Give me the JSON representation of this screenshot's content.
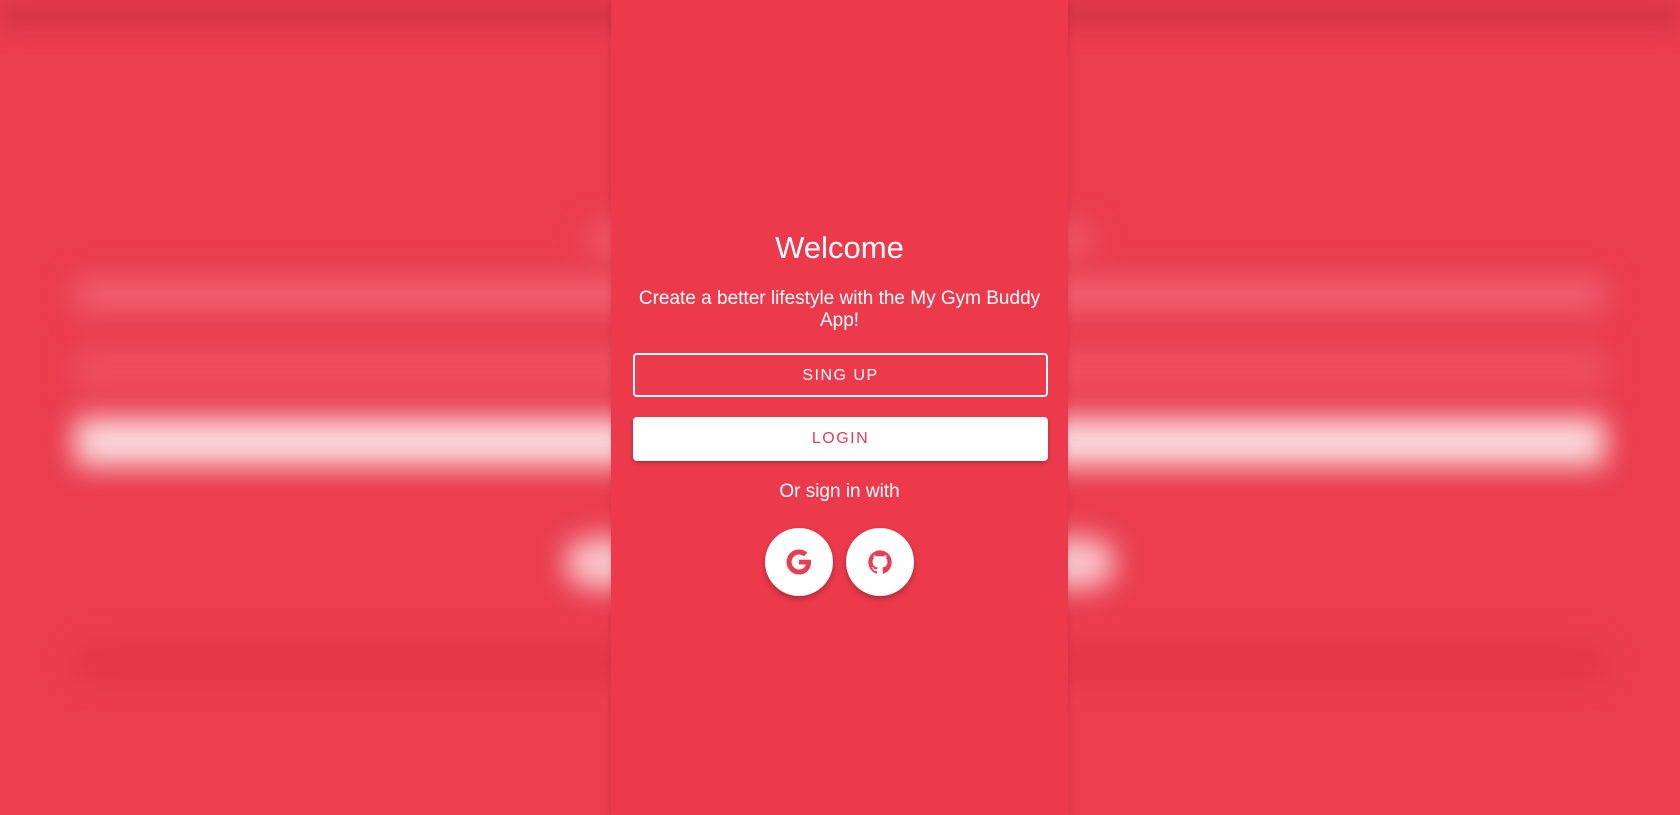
{
  "colors": {
    "brand_red": "#ea3d4f",
    "panel_red": "#ec3a4c",
    "white": "#ffffff"
  },
  "welcome": {
    "title": "Welcome",
    "tagline": "Create a better lifestyle with the My Gym Buddy App!"
  },
  "actions": {
    "signup_label": "SING UP",
    "login_label": "LOGIN"
  },
  "social": {
    "prompt": "Or sign in with",
    "providers": [
      {
        "name": "Google",
        "icon": "google-icon"
      },
      {
        "name": "GitHub",
        "icon": "github-icon"
      }
    ]
  }
}
